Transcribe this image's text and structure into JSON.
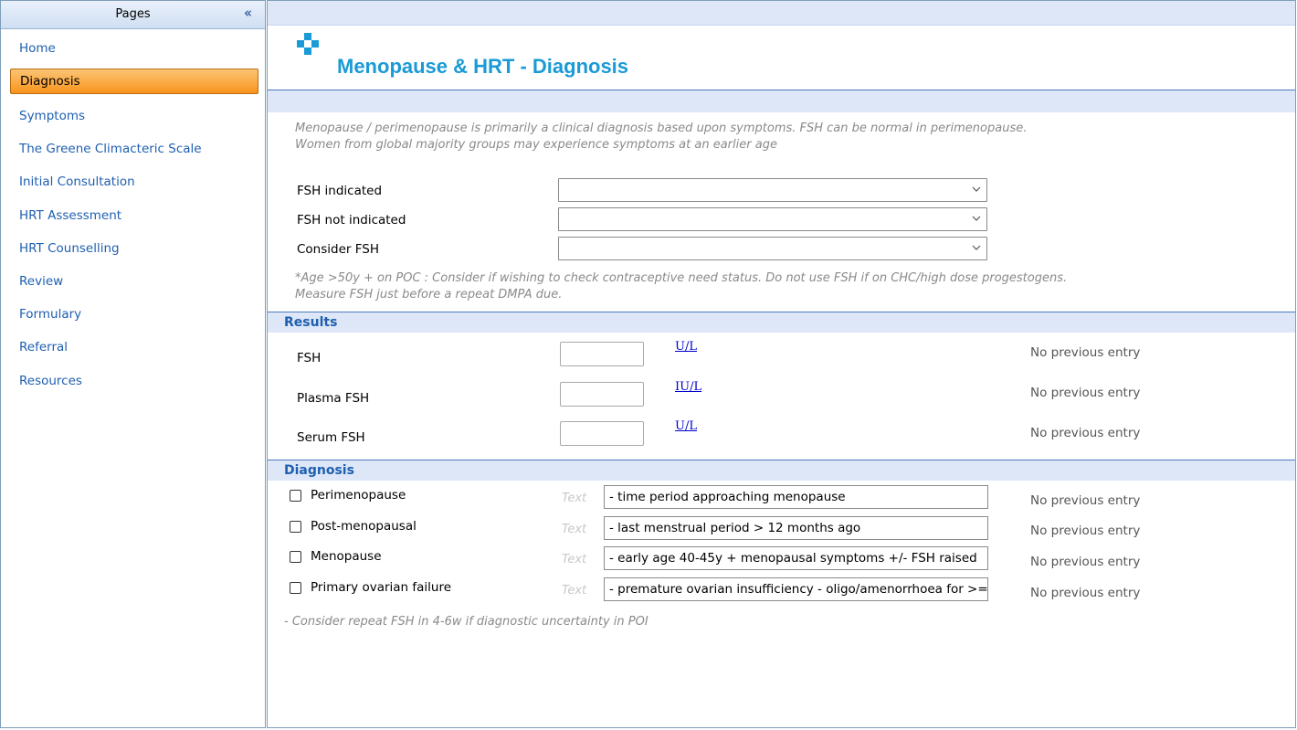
{
  "sidebar": {
    "title": "Pages",
    "collapse_label": "«",
    "items": [
      {
        "label": "Home"
      },
      {
        "label": "Diagnosis",
        "active": true
      },
      {
        "label": "Symptoms"
      },
      {
        "label": "The Greene Climacteric Scale"
      },
      {
        "label": "Initial Consultation"
      },
      {
        "label": "HRT Assessment"
      },
      {
        "label": "HRT Counselling"
      },
      {
        "label": "Review"
      },
      {
        "label": "Formulary"
      },
      {
        "label": "Referral"
      },
      {
        "label": "Resources"
      }
    ]
  },
  "header": {
    "title": "Menopause & HRT - Diagnosis",
    "icon": "medical-cross-icon",
    "icon_color": "#1a9ad6"
  },
  "intro": {
    "line1": "Menopause / perimenopause is primarily a clinical diagnosis based upon symptoms. FSH can be normal in perimenopause.",
    "line2": "Women from global majority groups may experience symptoms at an earlier age"
  },
  "fsh_fields": [
    {
      "label": "FSH indicated",
      "value": ""
    },
    {
      "label": "FSH not indicated",
      "value": ""
    },
    {
      "label": "Consider FSH",
      "value": ""
    }
  ],
  "fsh_note": {
    "line1": "*Age >50y + on POC : Consider if wishing to check contraceptive need status. Do not use FSH if on CHC/high dose progestogens.",
    "line2": "Measure FSH just before a repeat DMPA due."
  },
  "results": {
    "title": "Results",
    "rows": [
      {
        "label": "FSH",
        "value": "",
        "unit": "U/L",
        "previous": "No previous entry"
      },
      {
        "label": "Plasma FSH",
        "value": "",
        "unit": "IU/L",
        "previous": "No previous entry"
      },
      {
        "label": "Serum FSH",
        "value": "",
        "unit": "U/L",
        "previous": "No previous entry"
      }
    ]
  },
  "diagnosis": {
    "title": "Diagnosis",
    "text_hint": "Text",
    "rows": [
      {
        "label": "Perimenopause",
        "checked": false,
        "text": "- time period approaching menopause",
        "previous": "No previous entry"
      },
      {
        "label": "Post-menopausal",
        "checked": false,
        "text": "- last menstrual period > 12 months ago",
        "previous": "No previous entry"
      },
      {
        "label": "Menopause",
        "checked": false,
        "text": "- early age 40-45y + menopausal symptoms +/- FSH raised",
        "previous": "No previous entry"
      },
      {
        "label": "Primary ovarian failure",
        "checked": false,
        "text": "- premature ovarian insufficiency - oligo/amenorrhoea for >=",
        "previous": "No previous entry"
      }
    ],
    "footer_note": "- Consider repeat FSH in 4-6w if diagnostic uncertainty in POI"
  }
}
